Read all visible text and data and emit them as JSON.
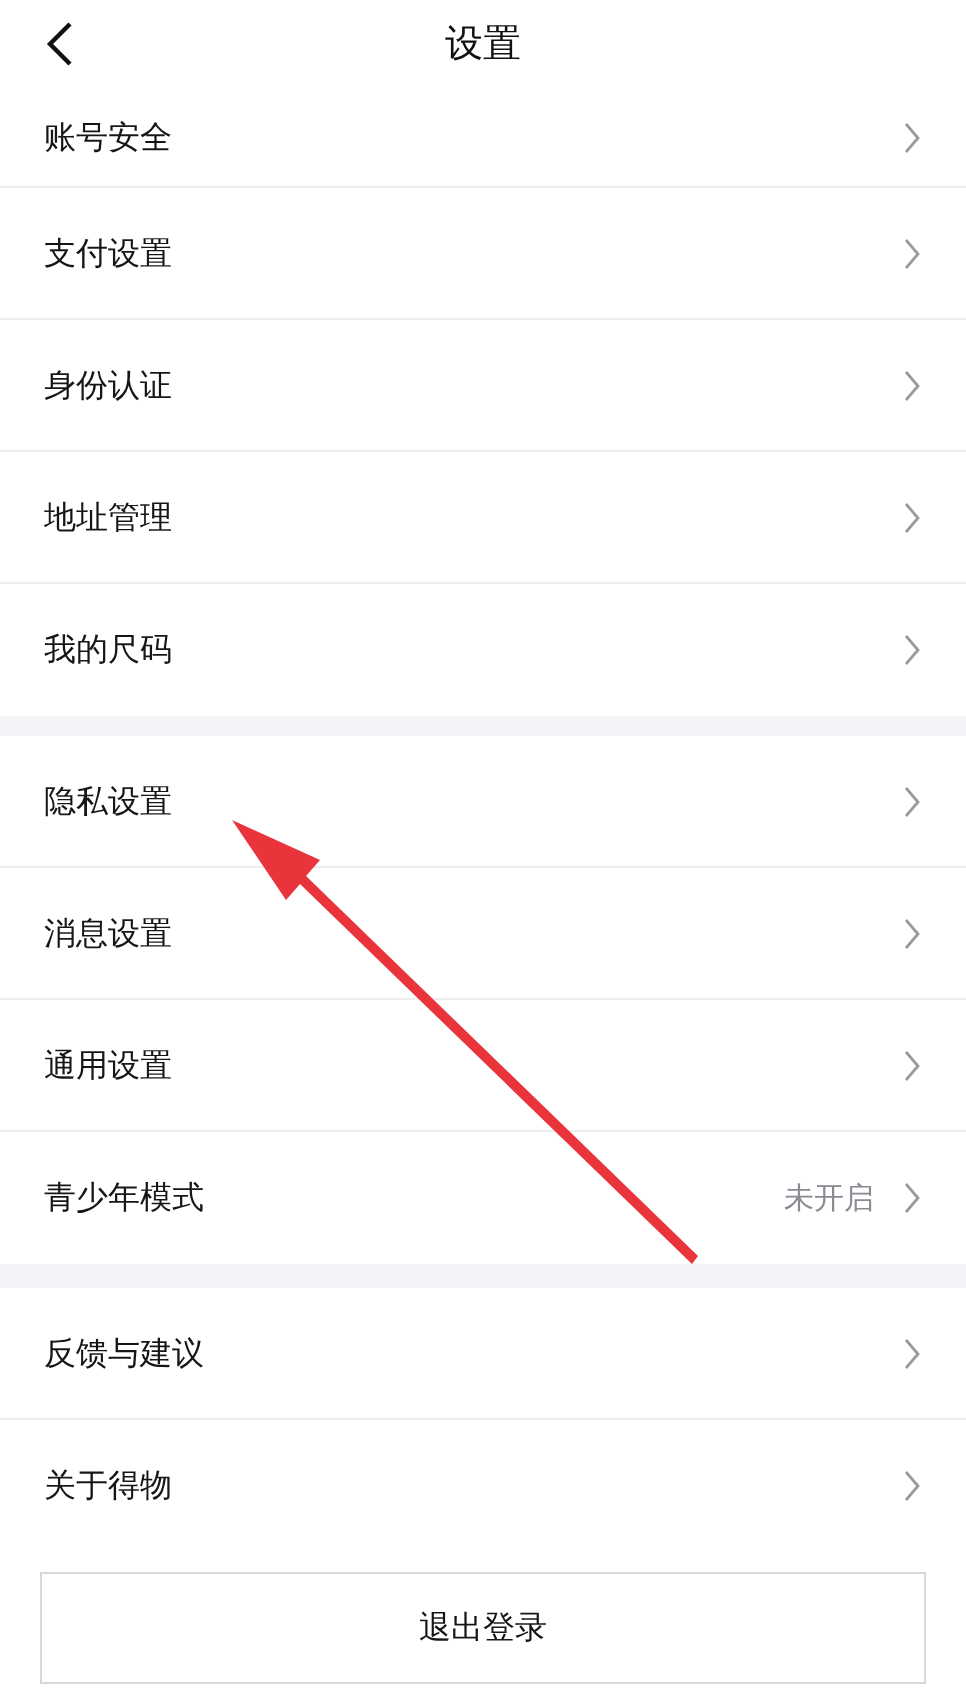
{
  "header": {
    "title": "设置"
  },
  "sections": [
    {
      "rows": [
        {
          "label": "账号安全"
        },
        {
          "label": "支付设置"
        },
        {
          "label": "身份认证"
        },
        {
          "label": "地址管理"
        },
        {
          "label": "我的尺码"
        }
      ]
    },
    {
      "rows": [
        {
          "label": "隐私设置"
        },
        {
          "label": "消息设置"
        },
        {
          "label": "通用设置"
        },
        {
          "label": "青少年模式",
          "value": "未开启"
        }
      ]
    },
    {
      "rows": [
        {
          "label": "反馈与建议"
        },
        {
          "label": "关于得物"
        }
      ]
    }
  ],
  "logout_button": "退出登录"
}
